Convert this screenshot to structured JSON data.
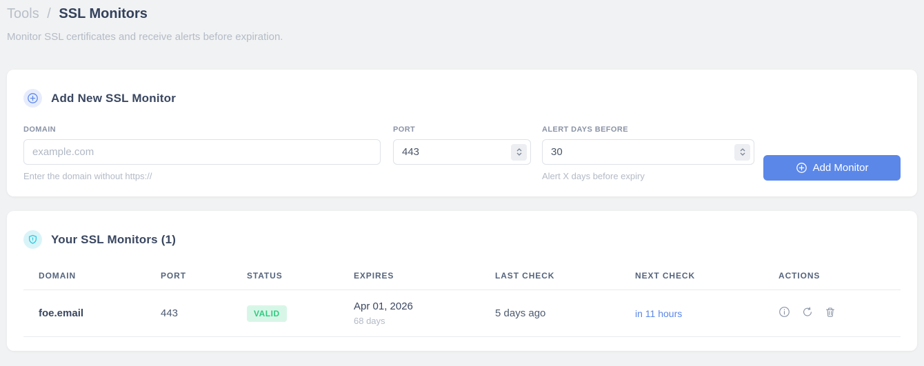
{
  "breadcrumb": {
    "section": "Tools",
    "separator": "/",
    "page": "SSL Monitors"
  },
  "subtitle": "Monitor SSL certificates and receive alerts before expiration.",
  "add_card": {
    "title": "Add New SSL Monitor",
    "icon": "plus-circle",
    "fields": {
      "domain": {
        "label": "DOMAIN",
        "placeholder": "example.com",
        "helper": "Enter the domain without https://"
      },
      "port": {
        "label": "PORT",
        "value": "443"
      },
      "alert_days": {
        "label": "ALERT DAYS BEFORE",
        "value": "30",
        "helper": "Alert X days before expiry"
      }
    },
    "submit_label": "Add Monitor"
  },
  "monitors_card": {
    "title": "Your SSL Monitors (1)",
    "icon": "shield",
    "table": {
      "headers": [
        "DOMAIN",
        "PORT",
        "STATUS",
        "EXPIRES",
        "LAST CHECK",
        "NEXT CHECK",
        "ACTIONS"
      ],
      "rows": [
        {
          "domain": "foe.email",
          "port": "443",
          "status": "VALID",
          "expires_date": "Apr 01, 2026",
          "expires_in": "68 days",
          "last_check": "5 days ago",
          "next_check": "in 11 hours",
          "actions": [
            "info",
            "refresh",
            "delete"
          ]
        }
      ]
    }
  },
  "colors": {
    "accent_blue": "#5b87e8",
    "badge_green_bg": "#d8f6e7",
    "badge_green_text": "#2fcb80",
    "shield_cyan": "#2bc9e0",
    "page_bg": "#f1f2f3"
  }
}
